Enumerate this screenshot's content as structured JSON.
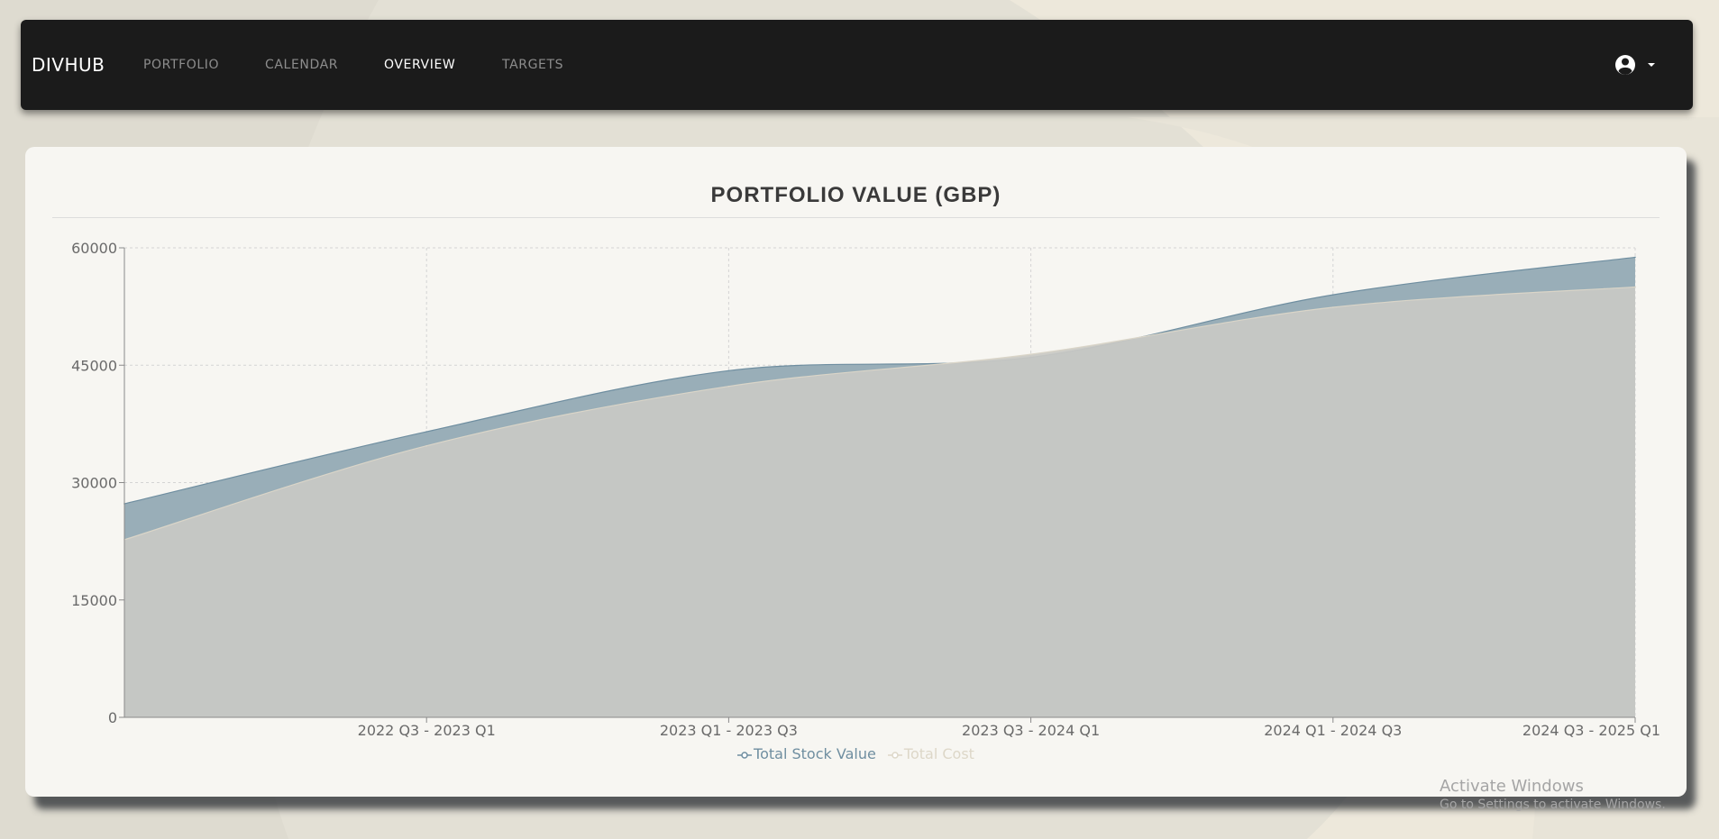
{
  "nav": {
    "brand": "DIVHUB",
    "items": [
      {
        "label": "PORTFOLIO",
        "active": false
      },
      {
        "label": "CALENDAR",
        "active": false
      },
      {
        "label": "OVERVIEW",
        "active": true
      },
      {
        "label": "TARGETS",
        "active": false
      }
    ],
    "user_icon": "user-circle-icon",
    "dropdown_icon": "caret-down-icon"
  },
  "chart_data": {
    "type": "area",
    "title": "PORTFOLIO VALUE (GBP)",
    "xlabel": "",
    "ylabel": "",
    "ylim": [
      0,
      60000
    ],
    "yticks": [
      "0",
      "15000",
      "30000",
      "45000",
      "60000"
    ],
    "x_tick_labels": [
      "2022 Q3 - 2023 Q1",
      "2023 Q1 - 2023 Q3",
      "2023 Q3 - 2024 Q1",
      "2024 Q1 - 2024 Q3",
      "2024 Q3 - 2025 Q1"
    ],
    "categories": [
      "",
      "2022 Q3 - 2023 Q1",
      "2023 Q1 - 2023 Q3",
      "2023 Q3 - 2024 Q1",
      "2024 Q1 - 2024 Q3",
      "2024 Q3 - 2025 Q1"
    ],
    "series": [
      {
        "name": "Total Stock Value",
        "values": [
          27300,
          36500,
          44300,
          46000,
          54000,
          58800
        ],
        "color": "#99aeb8"
      },
      {
        "name": "Total Cost",
        "values": [
          22700,
          34700,
          42300,
          46400,
          52400,
          55000
        ],
        "color": "#c9c9c4"
      }
    ],
    "grid": true,
    "legend": "bottom",
    "colors": {
      "stock_line": "#6f8ea0",
      "cost_line": "#dad5c8",
      "legend_cost_text": "#ddd7c8"
    }
  },
  "watermark": {
    "title": "Activate Windows",
    "subtitle": "Go to Settings to activate Windows."
  }
}
